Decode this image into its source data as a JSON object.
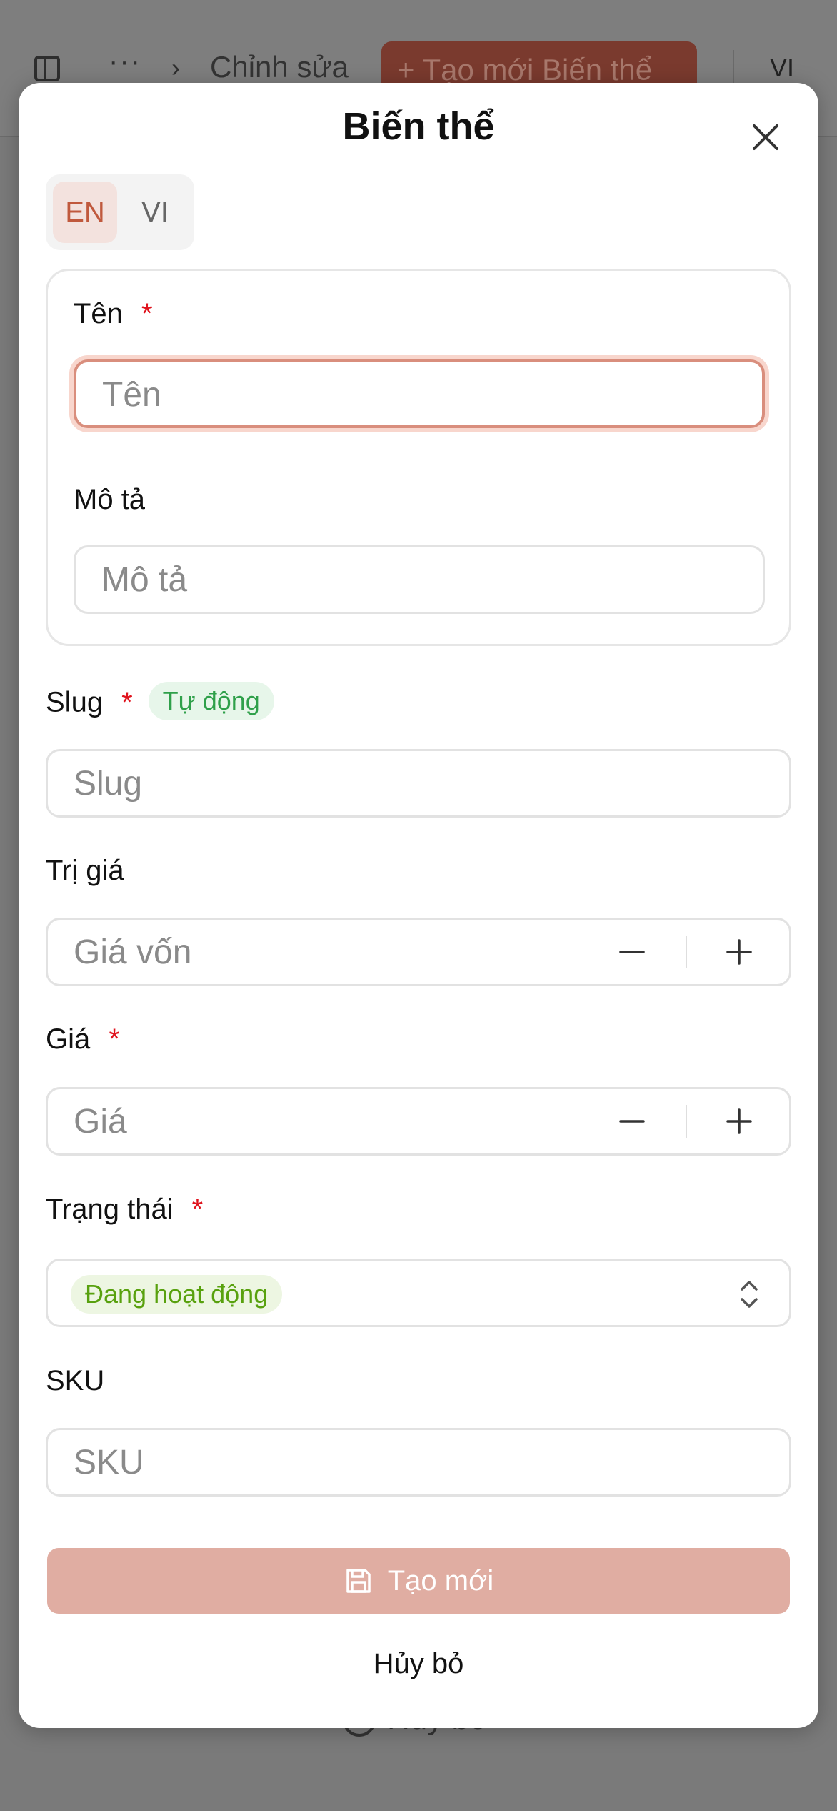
{
  "background": {
    "breadcrumb_ellipsis": "···",
    "breadcrumb_item": "Chỉnh sửa",
    "create_variant_button": "+ Tạo mới Biến thể",
    "language": "VI",
    "cancel_label": "Hủy bỏ"
  },
  "modal": {
    "title": "Biến thể",
    "language_tabs": [
      {
        "label": "EN",
        "active": true
      },
      {
        "label": "VI",
        "active": false
      }
    ],
    "fields": {
      "name": {
        "label": "Tên",
        "required": "*",
        "placeholder": "Tên",
        "value": ""
      },
      "description": {
        "label": "Mô tả",
        "placeholder": "Mô tả",
        "value": ""
      },
      "slug": {
        "label": "Slug",
        "required": "*",
        "badge": "Tự động",
        "placeholder": "Slug",
        "value": ""
      },
      "cost_value": {
        "label": "Trị giá",
        "placeholder": "Giá vốn",
        "value": ""
      },
      "price": {
        "label": "Giá",
        "required": "*",
        "placeholder": "Giá",
        "value": ""
      },
      "status": {
        "label": "Trạng thái",
        "required": "*",
        "selected": "Đang hoạt động"
      },
      "sku": {
        "label": "SKU",
        "placeholder": "SKU",
        "value": ""
      }
    },
    "submit_label": "Tạo mới",
    "cancel_label": "Hủy bỏ"
  },
  "colors": {
    "accent": "#c0593d",
    "primary_button_disabled": "#e0ada2",
    "required": "#e0131d",
    "badge_auto_text": "#2fa04a",
    "status_text": "#58a10e"
  },
  "icons": [
    "sidebar-toggle-icon",
    "chevron-right-icon",
    "close-icon",
    "minus-icon",
    "plus-icon",
    "chevron-up-down-icon",
    "save-icon"
  ]
}
